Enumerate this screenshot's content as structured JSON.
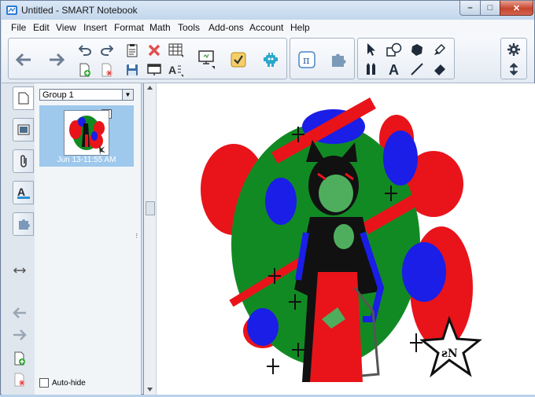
{
  "window": {
    "title": "Untitled - SMART Notebook",
    "controls": {
      "minimize": "–",
      "maximize": "□",
      "close": "✕"
    }
  },
  "menu": [
    "File",
    "Edit",
    "View",
    "Insert",
    "Format",
    "Math",
    "Tools",
    "Add-ons",
    "Account",
    "Help"
  ],
  "toolbar": {
    "icons": [
      "back-arrow-icon",
      "forward-arrow-icon",
      "undo-icon",
      "redo-icon",
      "add-page-icon",
      "delete-page-icon",
      "paste-icon",
      "save-icon",
      "delete-icon",
      "screen-shade-icon",
      "table-icon",
      "full-screen-icon",
      "document-camera-icon",
      "response-icon",
      "activity-builder-icon",
      "math-icon",
      "add-ons-icon",
      "select-icon",
      "shapes-icon",
      "fill-icon",
      "pens-icon",
      "text-icon",
      "line-icon",
      "eraser-icon",
      "settings-icon",
      "move-toolbar-icon"
    ]
  },
  "sidebar": {
    "tabs": [
      "page-sorter",
      "gallery",
      "attachments",
      "properties",
      "add-ons"
    ],
    "group_label": "Group 1",
    "page_number": "1",
    "page_date": "Jun 13-11:55 AM",
    "autohide_label": "Auto-hide"
  },
  "colors": {
    "red": "#e8141a",
    "blue": "#1a1ee6",
    "green": "#128a24",
    "black": "#111111"
  }
}
